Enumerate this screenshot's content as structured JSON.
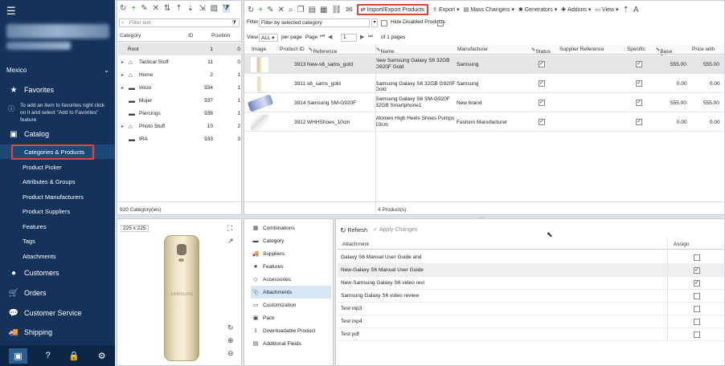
{
  "sidebar": {
    "region": "Mexico",
    "favorites": "Favorites",
    "favorites_hint": "To add an item to favorites right click on it and select \"Add to Favorites\" feature",
    "catalog": "Catalog",
    "catalog_items": [
      "Categories & Products",
      "Product Picker",
      "Attributes & Groups",
      "Product Manufacturers",
      "Product Suppliers",
      "Features",
      "Tags",
      "Attachments"
    ],
    "customers": "Customers",
    "orders": "Orders",
    "customer_service": "Customer Service",
    "shipping": "Shipping"
  },
  "categories": {
    "filter_placeholder": "Filter text",
    "col_category": "Category",
    "col_id": "ID",
    "col_position": "Position",
    "rows": [
      {
        "name": "Root",
        "id": "1",
        "pos": "0"
      },
      {
        "name": "Tactical Stuff",
        "id": "11",
        "pos": "0"
      },
      {
        "name": "Home",
        "id": "2",
        "pos": "1"
      },
      {
        "name": "Inicio",
        "id": "934",
        "pos": "1"
      },
      {
        "name": "Mujer",
        "id": "937",
        "pos": "1"
      },
      {
        "name": "Piercings",
        "id": "938",
        "pos": "1"
      },
      {
        "name": "Photo Stuff",
        "id": "10",
        "pos": "2"
      },
      {
        "name": "IRA",
        "id": "933",
        "pos": "3"
      }
    ],
    "footer": "920 Category(ies)"
  },
  "products": {
    "toolbar": {
      "import_export": "Import/Export Products",
      "export": "Export",
      "mass_changers": "Mass Changers",
      "generators": "Generators",
      "addons": "Addons",
      "view": "View"
    },
    "filter_label": "Filter",
    "filter_value": "Filter by selected category",
    "hide_disabled": "Hide Disabled Products",
    "view_label": "View",
    "view_value": "ALL",
    "per_page": "per page",
    "page_label": "Page",
    "page_value": "1",
    "of_pages": "of 1 pages",
    "columns": [
      "Image",
      "Product ID",
      "Reference",
      "Name",
      "Manufacturer",
      "Status",
      "Supplier Reference",
      "Specific",
      "Base Price",
      "Price with"
    ],
    "rows": [
      {
        "id": "3913",
        "ref": "New-s6_sams_gold",
        "name": "New Samsung Galaxy S6 32GB G920F Gold",
        "mfr": "Samsung",
        "base": "555.00",
        "price": "555.00"
      },
      {
        "id": "3911",
        "ref": "s6_sams_gold",
        "name": "Samsung Galaxy S6 32GB G920F Gold",
        "mfr": "Samsung",
        "base": "0.00",
        "price": "0.00"
      },
      {
        "id": "3914",
        "ref": "Samsung SM-G920F",
        "name": "Samsung Galaxy S6 SM-G920F 32GB Smartphone1",
        "mfr": "New brand",
        "base": "555.00",
        "price": "555.00"
      },
      {
        "id": "3912",
        "ref": "WHHShoes_10cm",
        "name": "Women High Heels Shoes Pumps 10cm",
        "mfr": "Fashion Manufacturer",
        "base": "0.00",
        "price": "0.00"
      }
    ],
    "footer": "4 Product(s)"
  },
  "preview": {
    "size_label": "225 x 225",
    "brand": "SAMSUNG"
  },
  "tabs": [
    "Combinations",
    "Category",
    "Suppliers",
    "Features",
    "Accessories",
    "Attachments",
    "Customization",
    "Pack",
    "Downloadable Product",
    "Additional Fields"
  ],
  "attachments": {
    "refresh": "Refresh",
    "apply": "Apply Changes",
    "col_attachment": "Attachment",
    "col_assign": "Assign",
    "rows": [
      {
        "name": "Galaxy S6 Manual User Guide and",
        "assigned": false
      },
      {
        "name": "New-Galaxy S6 Manual User Guide",
        "assigned": true
      },
      {
        "name": "New-Samsung Galaxy S6 video revi",
        "assigned": true
      },
      {
        "name": "Samsung Galaxy S6 video review",
        "assigned": false
      },
      {
        "name": "Test mp3",
        "assigned": false
      },
      {
        "name": "Test mp4",
        "assigned": false
      },
      {
        "name": "Test pdf",
        "assigned": false
      }
    ]
  }
}
